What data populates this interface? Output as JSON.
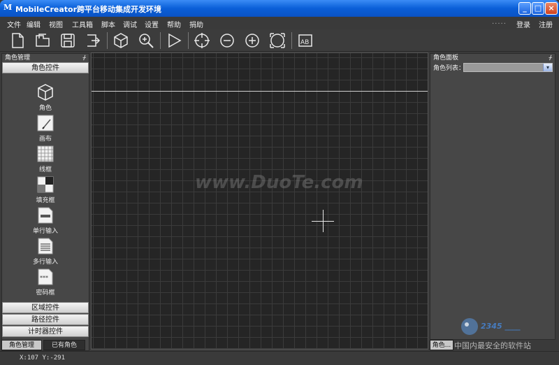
{
  "window": {
    "title": "MobileCreator跨平台移动集成开发环境",
    "app_icon": "M",
    "minimize": "_",
    "maximize": "□",
    "close": "×"
  },
  "menu": {
    "items": [
      "文件",
      "编辑",
      "视图",
      "工具箱",
      "脚本",
      "调试",
      "设置",
      "帮助",
      "捐助"
    ],
    "dots": ".....",
    "login": "登录",
    "register": "注册"
  },
  "toolbar": {
    "icons": [
      "new-file-icon",
      "open-folder-icon",
      "save-icon",
      "export-icon",
      "box-icon",
      "zoom-icon",
      "play-icon",
      "crosshair-icon",
      "zoom-out-icon",
      "zoom-in-icon",
      "fit-screen-icon",
      "ab-icon"
    ]
  },
  "left_panel": {
    "title": "角色管理",
    "pin": "ᚋ",
    "section_controls": "角色控件",
    "tools": [
      "角色",
      "画布",
      "线框",
      "填充框",
      "单行输入",
      "多行输入",
      "密码框"
    ],
    "section_region": "区域控件",
    "section_path": "路径控件",
    "section_timer": "计时器控件",
    "tab_manage": "角色管理",
    "tab_existing": "已有角色"
  },
  "canvas": {
    "watermark": "www.DuoTe.com"
  },
  "right_panel": {
    "title": "角色面板",
    "pin": "ᚋ",
    "list_label": "角色列表：",
    "list_value": "",
    "dropdown_arrow": "▾",
    "tab": "角色..."
  },
  "watermark_bottom": "中国内最安全的软件站",
  "status": {
    "coords": "X:107 Y:-291"
  },
  "colors": {
    "titlebar": "#0a5fd8",
    "canvas_bg": "#252525",
    "panel_bg": "#474747"
  }
}
